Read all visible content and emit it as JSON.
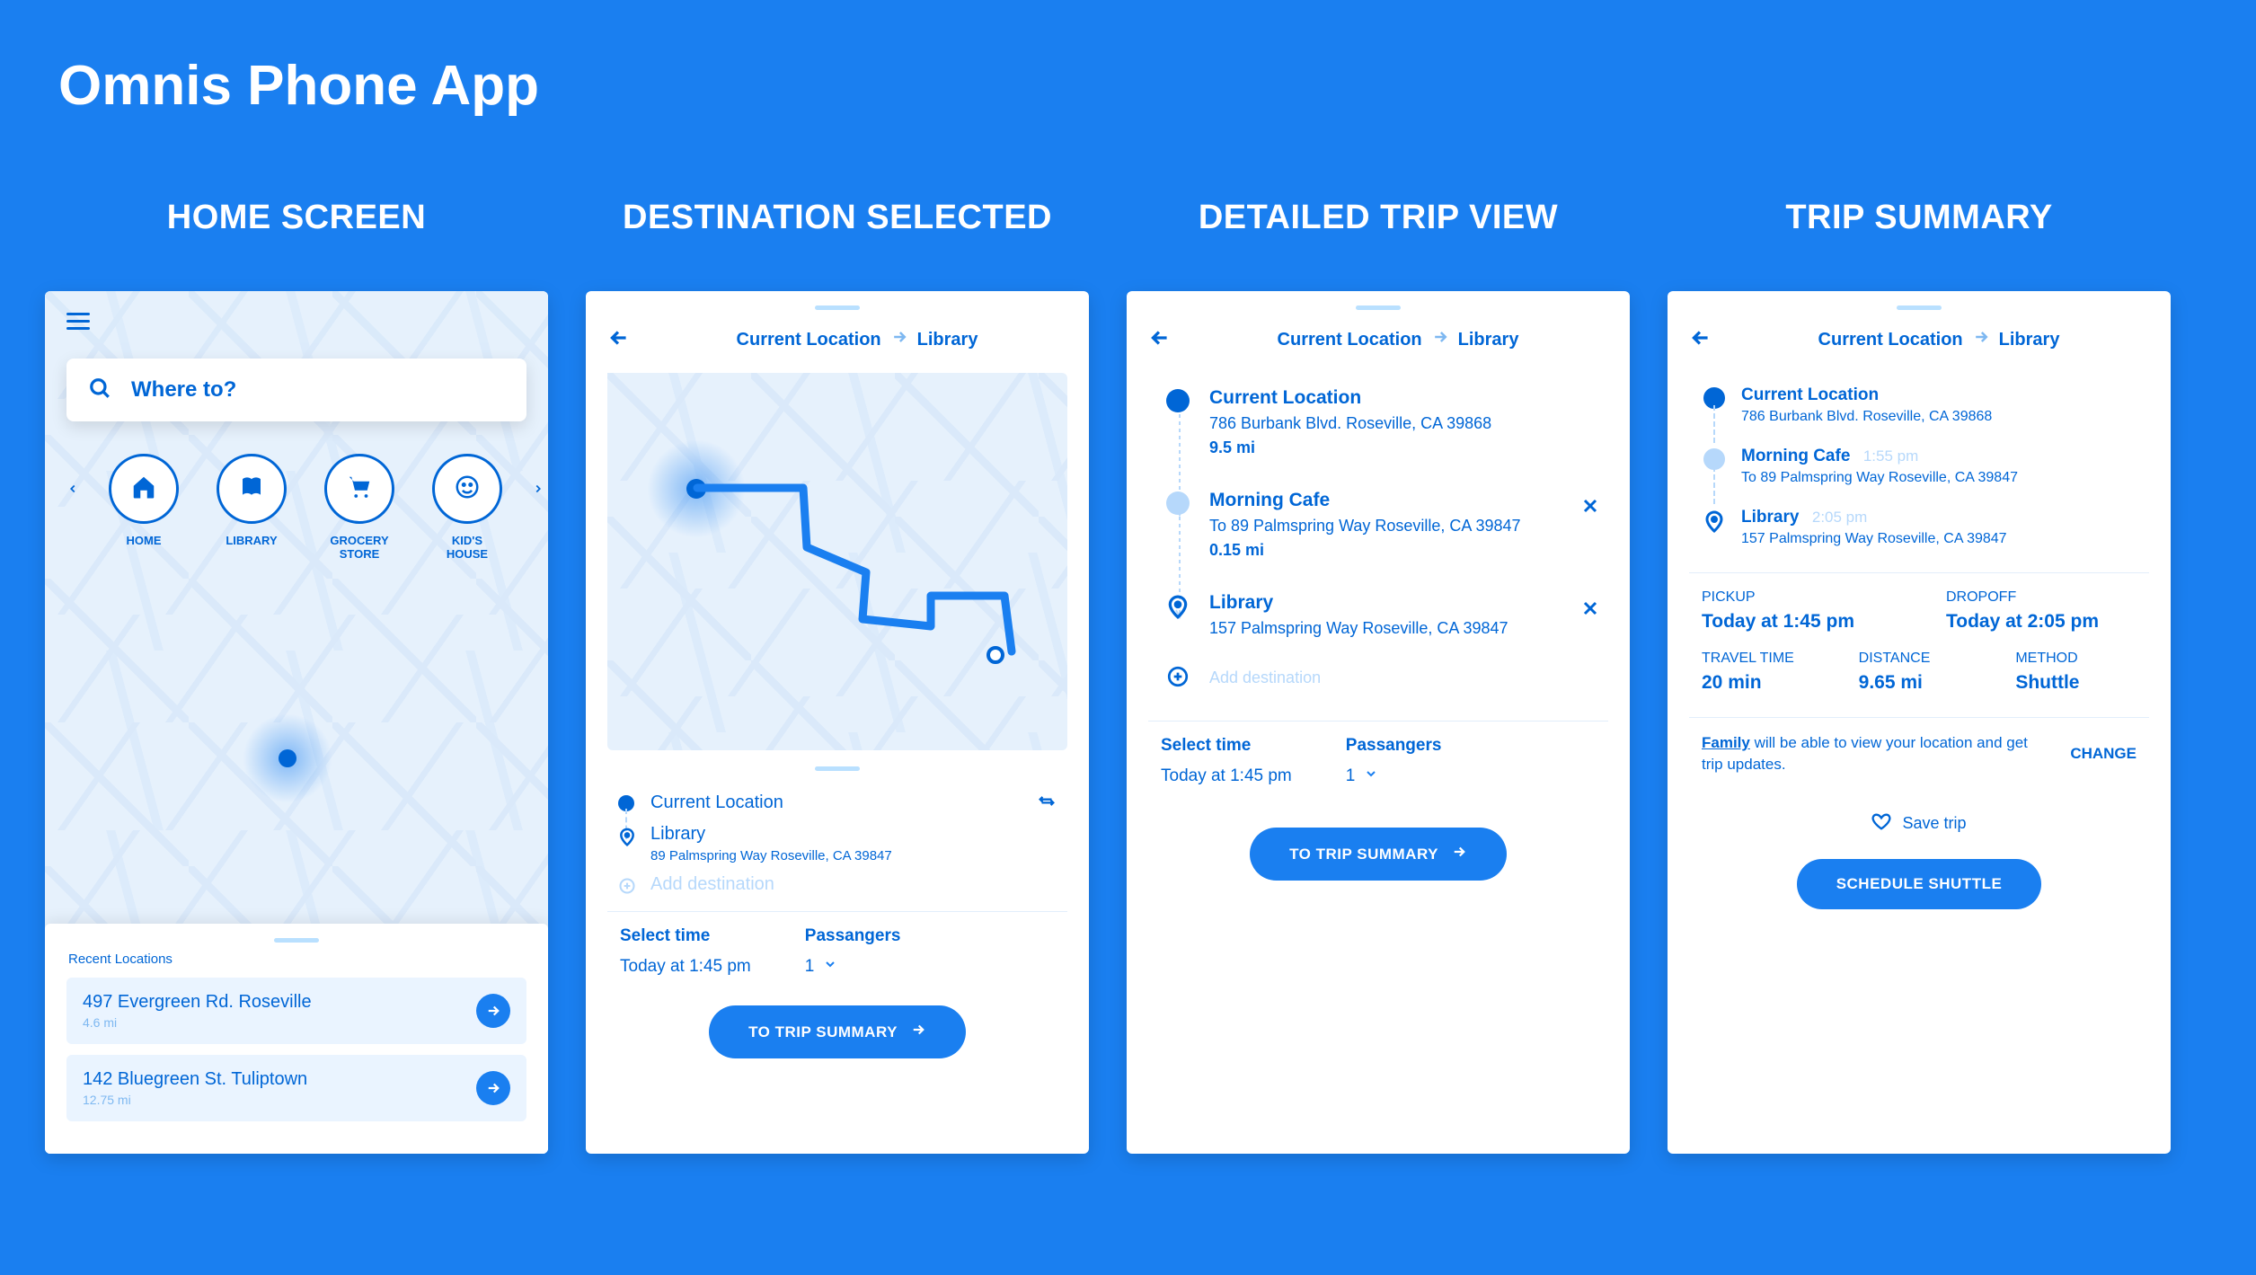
{
  "app_title": "Omnis Phone App",
  "screens": [
    {
      "title": "HOME SCREEN"
    },
    {
      "title": "DESTINATION SELECTED"
    },
    {
      "title": "DETAILED TRIP VIEW"
    },
    {
      "title": "TRIP SUMMARY"
    }
  ],
  "home": {
    "search_placeholder": "Where to?",
    "shortcuts": [
      {
        "label": "HOME",
        "icon": "home-icon"
      },
      {
        "label": "LIBRARY",
        "icon": "book-icon"
      },
      {
        "label": "GROCERY\nSTORE",
        "icon": "cart-icon"
      },
      {
        "label": "KID'S\nHOUSE",
        "icon": "child-icon"
      }
    ],
    "recent_heading": "Recent Locations",
    "recent": [
      {
        "name": "497 Evergreen Rd. Roseville",
        "distance": "4.6 mi"
      },
      {
        "name": "142 Bluegreen St. Tuliptown",
        "distance": "12.75 mi"
      }
    ]
  },
  "dest": {
    "crumb_from": "Current Location",
    "crumb_to": "Library",
    "stops": {
      "from": "Current Location",
      "to": "Library",
      "to_addr": "89 Palmspring Way Roseville, CA 39847",
      "add_label": "Add destination"
    },
    "select_time_label": "Select time",
    "select_time_value": "Today at 1:45 pm",
    "passengers_label": "Passangers",
    "passengers_value": "1",
    "cta": "TO TRIP SUMMARY"
  },
  "detail": {
    "crumb_from": "Current Location",
    "crumb_to": "Library",
    "stops": [
      {
        "title": "Current Location",
        "addr": "786 Burbank Blvd. Roseville, CA 39868",
        "distance": "9.5 mi",
        "bullet": "solid",
        "removable": false
      },
      {
        "title": "Morning Cafe",
        "addr": "To 89 Palmspring Way Roseville, CA 39847",
        "distance": "0.15 mi",
        "bullet": "light",
        "removable": true
      },
      {
        "title": "Library",
        "addr": "157 Palmspring Way Roseville, CA 39847",
        "distance": "",
        "bullet": "pin",
        "removable": true
      }
    ],
    "add_label": "Add destination",
    "select_time_label": "Select time",
    "select_time_value": "Today at 1:45 pm",
    "passengers_label": "Passangers",
    "passengers_value": "1",
    "cta": "TO TRIP SUMMARY"
  },
  "summary": {
    "crumb_from": "Current Location",
    "crumb_to": "Library",
    "stops": [
      {
        "title": "Current Location",
        "time": "",
        "addr": "786 Burbank Blvd. Roseville, CA 39868",
        "bullet": "solid"
      },
      {
        "title": "Morning Cafe",
        "time": "1:55 pm",
        "addr": "To 89 Palmspring Way Roseville, CA 39847",
        "bullet": "light"
      },
      {
        "title": "Library",
        "time": "2:05 pm",
        "addr": "157 Palmspring Way Roseville, CA 39847",
        "bullet": "pin"
      }
    ],
    "pickup_label": "PICKUP",
    "pickup_value": "Today at 1:45 pm",
    "dropoff_label": "DROPOFF",
    "dropoff_value": "Today at 2:05 pm",
    "travel_label": "TRAVEL TIME",
    "travel_value": "20 min",
    "distance_label": "DISTANCE",
    "distance_value": "9.65 mi",
    "method_label": "METHOD",
    "method_value": "Shuttle",
    "share_family": "Family",
    "share_text": " will be able to view your location and get trip updates.",
    "change_label": "CHANGE",
    "save_label": "Save trip",
    "cta": "SCHEDULE SHUTTLE"
  }
}
